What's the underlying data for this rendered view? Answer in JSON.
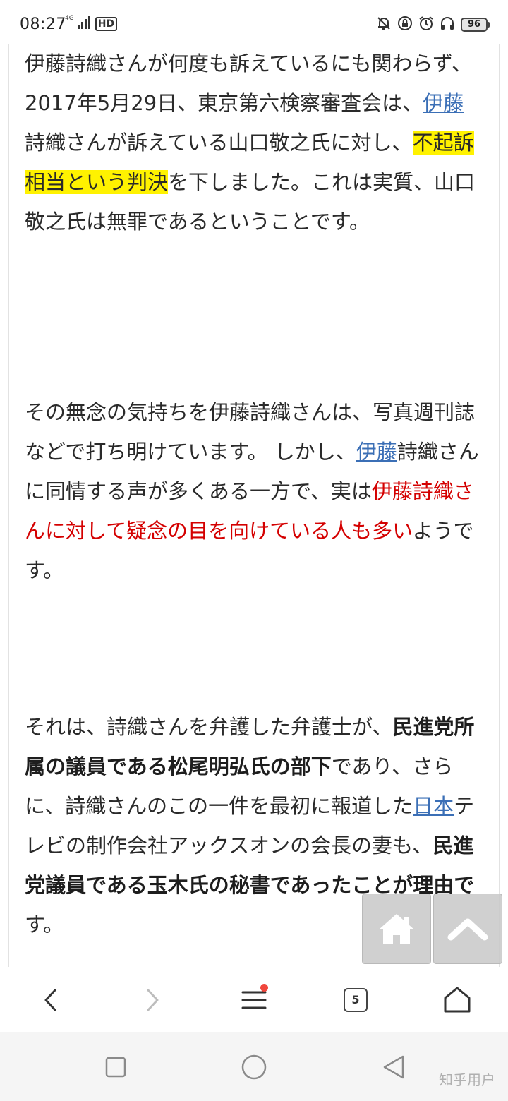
{
  "status_bar": {
    "time": "08:27",
    "network_label": "4G",
    "hd_label": "HD",
    "battery_level": "96",
    "icons": [
      "signal-icon",
      "hd-icon",
      "mute-bell-icon",
      "lock-rotation-icon",
      "alarm-icon",
      "headphones-icon",
      "battery-icon"
    ]
  },
  "article": {
    "p1": {
      "s1": "伊藤詩織さんが何度も訴えているにも関わらず、2017年5月29日、東京第六検察審査会は、",
      "link1": "伊藤",
      "s2": "詩織さんが訴えている山口敬之氏に対し、",
      "highlight": "不起訴相当という判決",
      "s3": "を下しました。これは実質、山口敬之氏は無罪であるということです。"
    },
    "p2": {
      "s1": "その無念の気持ちを伊藤詩織さんは、写真週刊誌などで打ち明けています。 しかし、",
      "link1": "伊藤",
      "s2": "詩織さんに同情する声が多くある一方で、実は",
      "red": "伊藤詩織さんに対して疑念の目を向けている人も多い",
      "s3": "ようです。"
    },
    "p3": {
      "s1": "それは、詩織さんを弁護した弁護士が、",
      "b1": "民進党所属の議員である松尾明弘氏の部下",
      "s2": "であり、さらに、詩織さんのこの一件を最初に報道した",
      "link1": "日本",
      "s3": "テレビの制作会社アックスオンの会長の妻も、",
      "b2": "民進党議員である玉木氏の秘書であったことが理由で",
      "s4": "す。"
    }
  },
  "floating_buttons": [
    "home-icon",
    "scroll-top-icon"
  ],
  "toolbar": {
    "tab_count": "5",
    "menu_badge_color": "#f0463c"
  },
  "system_nav": {
    "watermark": "知乎用户"
  },
  "colors": {
    "link": "#3b6fb6",
    "highlight": "#fff200",
    "emphasis_red": "#d40000"
  }
}
